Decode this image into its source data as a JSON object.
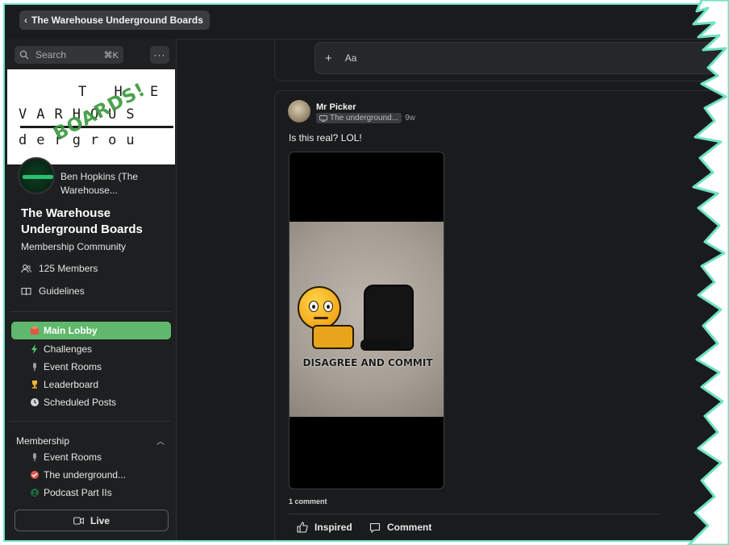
{
  "colors": {
    "accent": "#5fb86b",
    "background": "#1a1b1c",
    "sidebar": "#1e1f20",
    "border_glow": "#6fe3c3"
  },
  "topbar": {
    "back_label": "The Warehouse Underground Boards",
    "back_icon": "chevron-left-icon"
  },
  "sidebar": {
    "search_placeholder": "Search",
    "search_shortcut": "⌘K",
    "more_label": "···",
    "banner": {
      "line1": "T H E",
      "line2": "VARHOUS",
      "line3": "dergrou",
      "stamp": "BOARDS!"
    },
    "owner_name": "Ben Hopkins (The Warehouse...",
    "community_title": "The Warehouse Underground Boards",
    "community_subtitle": "Membership Community",
    "members_label": "125 Members",
    "guidelines_label": "Guidelines",
    "nav_items": [
      {
        "label": "Main Lobby",
        "icon": "lobby-icon",
        "active": true
      },
      {
        "label": "Challenges",
        "icon": "lightning-icon",
        "active": false
      },
      {
        "label": "Event Rooms",
        "icon": "microphone-icon",
        "active": false
      },
      {
        "label": "Leaderboard",
        "icon": "trophy-icon",
        "active": false
      },
      {
        "label": "Scheduled Posts",
        "icon": "clock-icon",
        "active": false
      }
    ],
    "membership_section": {
      "title": "Membership",
      "items": [
        {
          "label": "Event Rooms",
          "icon": "microphone-icon"
        },
        {
          "label": "The underground...",
          "icon": "shield-icon"
        },
        {
          "label": "Podcast Part IIs",
          "icon": "podcast-icon"
        }
      ]
    },
    "live_label": "Live"
  },
  "composer": {
    "plus_label": "+",
    "format_label": "Aa"
  },
  "post": {
    "author": "Mr Picker",
    "channel": "The underground...",
    "time": "9w",
    "text": "Is this real? LOL!",
    "image_caption": "DISAGREE AND COMMIT",
    "comment_count": "1 comment",
    "actions": {
      "inspired": "Inspired",
      "comment": "Comment"
    }
  }
}
